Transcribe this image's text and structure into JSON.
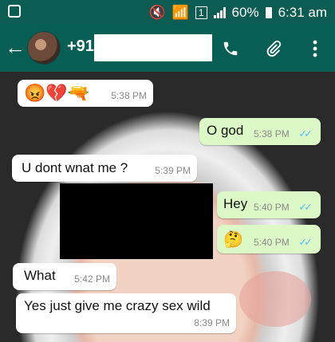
{
  "status": {
    "battery": "60%",
    "time": "6:31 am",
    "sim": "1"
  },
  "header": {
    "contact": "+91",
    "back_icon": "arrow-left-icon",
    "call_icon": "phone-icon",
    "attach_icon": "paperclip-icon",
    "menu_icon": "more-vertical-icon"
  },
  "messages": [
    {
      "text": "😡💔🔫",
      "time": "5:38 PM",
      "side": "in"
    },
    {
      "text": "O god",
      "time": "5:38 PM",
      "side": "out",
      "ticks": "✓✓"
    },
    {
      "text": "U dont wnat me ?",
      "time": "5:39 PM",
      "side": "in"
    },
    {
      "text": "Hey",
      "time": "5:40 PM",
      "side": "out",
      "ticks": "✓✓"
    },
    {
      "text": "🤔",
      "time": "5:40 PM",
      "side": "out",
      "ticks": "✓✓"
    },
    {
      "text": "What",
      "time": "5:42 PM",
      "side": "in"
    },
    {
      "text": "Yes just give me crazy sex wild",
      "time": "8:39 PM",
      "side": "in"
    }
  ]
}
